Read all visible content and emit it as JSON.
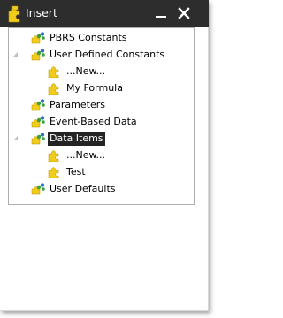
{
  "window": {
    "title": "Insert",
    "controls": {
      "minimize": "minimize",
      "close": "close"
    }
  },
  "tree": {
    "nodes": [
      {
        "label": "PBRS Constants",
        "icon": "puzzle-molecule-icon",
        "level": 0,
        "expanded": null,
        "selected": false
      },
      {
        "label": "User Defined Constants",
        "icon": "puzzle-molecule-icon",
        "level": 0,
        "expanded": true,
        "selected": false
      },
      {
        "label": "...New...",
        "icon": "puzzle-icon",
        "level": 1,
        "expanded": null,
        "selected": false
      },
      {
        "label": "My Formula",
        "icon": "puzzle-icon",
        "level": 1,
        "expanded": null,
        "selected": false
      },
      {
        "label": "Parameters",
        "icon": "puzzle-molecule-icon",
        "level": 0,
        "expanded": null,
        "selected": false
      },
      {
        "label": "Event-Based Data",
        "icon": "puzzle-molecule-icon",
        "level": 0,
        "expanded": null,
        "selected": false
      },
      {
        "label": "Data Items",
        "icon": "puzzle-molecule-icon",
        "level": 0,
        "expanded": true,
        "selected": true
      },
      {
        "label": "...New...",
        "icon": "puzzle-icon",
        "level": 1,
        "expanded": null,
        "selected": false
      },
      {
        "label": "Test",
        "icon": "puzzle-icon",
        "level": 1,
        "expanded": null,
        "selected": false
      },
      {
        "label": "User Defaults",
        "icon": "puzzle-molecule-icon",
        "level": 0,
        "expanded": null,
        "selected": false
      }
    ]
  },
  "colors": {
    "titlebar": "#2d2d2d",
    "selection": "#242424",
    "puzzle": "#f2cc1a",
    "molecule_green": "#3aa23a",
    "molecule_blue": "#2f6fd0"
  }
}
